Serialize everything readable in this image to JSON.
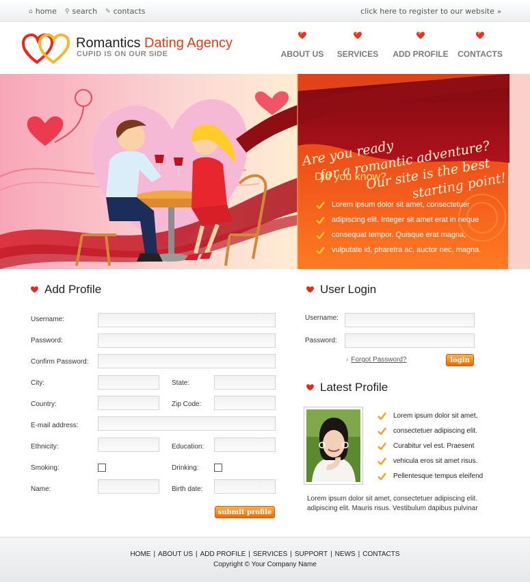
{
  "topbar": {
    "links": [
      {
        "label": "home",
        "icon": "home-icon"
      },
      {
        "label": "search",
        "icon": "search-icon"
      },
      {
        "label": "contacts",
        "icon": "pencil-icon"
      }
    ],
    "register": "click here to register to our website",
    "register_arrow": "»"
  },
  "header": {
    "brand_part1": "Romantics ",
    "brand_part2": "Dating Agency",
    "tagline": "CUPID IS ON OUR SIDE",
    "nav": [
      "ABOUT US",
      "SERVICES",
      "ADD PROFILE",
      "CONTACTS"
    ],
    "colors": {
      "accent": "#e23c12",
      "nav_text": "#7a7a7a"
    }
  },
  "banner": {
    "slogan": [
      "Are you ready",
      "for a romantic adventure?",
      "Our site is the best",
      "starting point!"
    ],
    "did_you_know": "Did you know?",
    "items": [
      "Lorem ipsum dolor sit amet, consectetuer",
      "adipiscing elit. Integer sit amet erat in neque",
      "consequat tempor. Quisque erat magna,",
      "vulputate id, pharetra ac, auctor nec, magna."
    ]
  },
  "add_profile": {
    "title": "Add Profile",
    "fields": {
      "username": "Username:",
      "password": "Password:",
      "confirm_password": "Confirm Password:",
      "city": "City:",
      "state": "State:",
      "country": "Country:",
      "zip": "Zip Code:",
      "email": "E-mail address:",
      "ethnicity": "Ethnicity:",
      "education": "Education:",
      "smoking": "Smoking:",
      "drinking": "Drinking:",
      "name": "Name:",
      "birth_date": "Birth date:"
    },
    "submit": "submit profile"
  },
  "user_login": {
    "title": "User Login",
    "username": "Username:",
    "password": "Password:",
    "forgot_arrow": "›",
    "forgot": "Forgot Password?",
    "login": "login"
  },
  "latest_profile": {
    "title": "Latest Profile",
    "items": [
      "Lorem ipsum dolor sit amet,",
      "consectetuer adipiscing elit.",
      "Curabitur vel est. Praesent",
      "vehicula eros sit amet risus.",
      "Pellentesque tempus eleifend"
    ],
    "text": "Lorem ipsum dolor sit amet, consectetuer adipiscing elit. adipiscing elit. Mauris risus. Vestibulum dapibus pulvinar"
  },
  "footer": {
    "nav": [
      "HOME",
      "ABOUT US",
      "ADD PROFILE",
      "SERVICES",
      "SUPPORT",
      "NEWS",
      "CONTACTS"
    ],
    "separator": "|",
    "copyright": "Copyright © Your Company Name"
  }
}
